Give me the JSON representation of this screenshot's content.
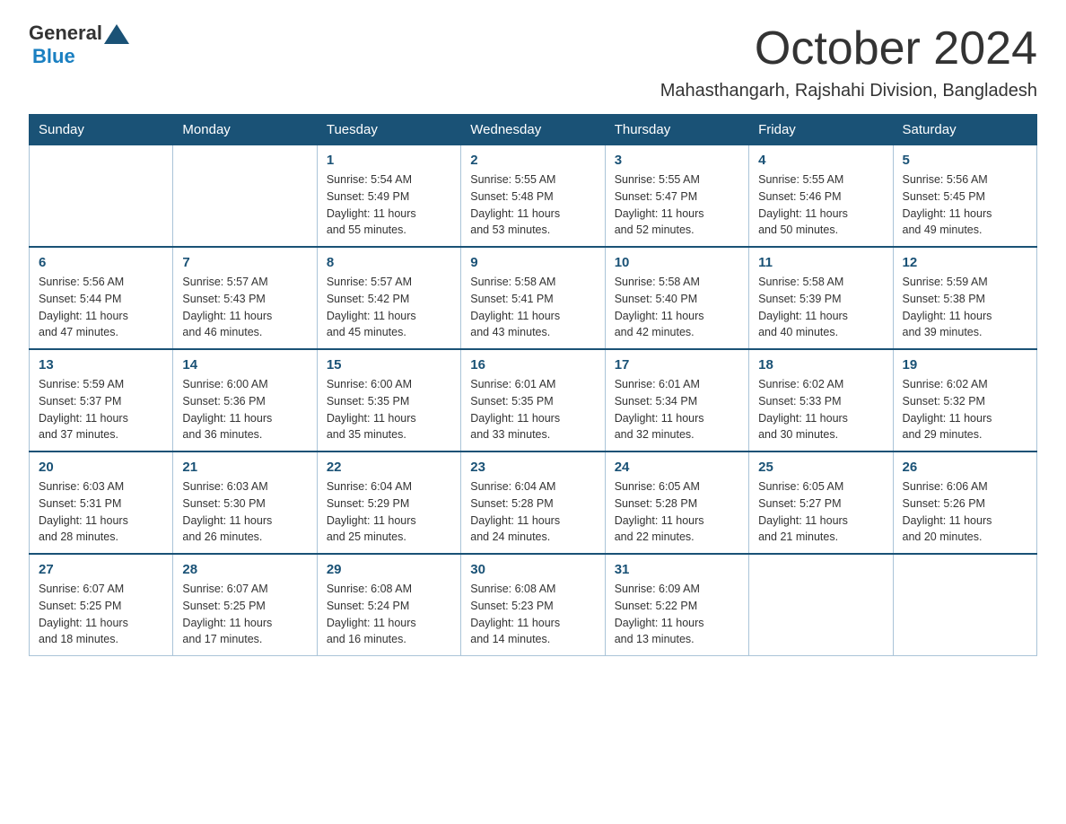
{
  "logo": {
    "general": "General",
    "blue": "Blue",
    "triangle_color": "#1a5276"
  },
  "title": "October 2024",
  "subtitle": "Mahasthangarh, Rajshahi Division, Bangladesh",
  "days_of_week": [
    "Sunday",
    "Monday",
    "Tuesday",
    "Wednesday",
    "Thursday",
    "Friday",
    "Saturday"
  ],
  "weeks": [
    [
      {
        "day": "",
        "info": ""
      },
      {
        "day": "",
        "info": ""
      },
      {
        "day": "1",
        "info": "Sunrise: 5:54 AM\nSunset: 5:49 PM\nDaylight: 11 hours\nand 55 minutes."
      },
      {
        "day": "2",
        "info": "Sunrise: 5:55 AM\nSunset: 5:48 PM\nDaylight: 11 hours\nand 53 minutes."
      },
      {
        "day": "3",
        "info": "Sunrise: 5:55 AM\nSunset: 5:47 PM\nDaylight: 11 hours\nand 52 minutes."
      },
      {
        "day": "4",
        "info": "Sunrise: 5:55 AM\nSunset: 5:46 PM\nDaylight: 11 hours\nand 50 minutes."
      },
      {
        "day": "5",
        "info": "Sunrise: 5:56 AM\nSunset: 5:45 PM\nDaylight: 11 hours\nand 49 minutes."
      }
    ],
    [
      {
        "day": "6",
        "info": "Sunrise: 5:56 AM\nSunset: 5:44 PM\nDaylight: 11 hours\nand 47 minutes."
      },
      {
        "day": "7",
        "info": "Sunrise: 5:57 AM\nSunset: 5:43 PM\nDaylight: 11 hours\nand 46 minutes."
      },
      {
        "day": "8",
        "info": "Sunrise: 5:57 AM\nSunset: 5:42 PM\nDaylight: 11 hours\nand 45 minutes."
      },
      {
        "day": "9",
        "info": "Sunrise: 5:58 AM\nSunset: 5:41 PM\nDaylight: 11 hours\nand 43 minutes."
      },
      {
        "day": "10",
        "info": "Sunrise: 5:58 AM\nSunset: 5:40 PM\nDaylight: 11 hours\nand 42 minutes."
      },
      {
        "day": "11",
        "info": "Sunrise: 5:58 AM\nSunset: 5:39 PM\nDaylight: 11 hours\nand 40 minutes."
      },
      {
        "day": "12",
        "info": "Sunrise: 5:59 AM\nSunset: 5:38 PM\nDaylight: 11 hours\nand 39 minutes."
      }
    ],
    [
      {
        "day": "13",
        "info": "Sunrise: 5:59 AM\nSunset: 5:37 PM\nDaylight: 11 hours\nand 37 minutes."
      },
      {
        "day": "14",
        "info": "Sunrise: 6:00 AM\nSunset: 5:36 PM\nDaylight: 11 hours\nand 36 minutes."
      },
      {
        "day": "15",
        "info": "Sunrise: 6:00 AM\nSunset: 5:35 PM\nDaylight: 11 hours\nand 35 minutes."
      },
      {
        "day": "16",
        "info": "Sunrise: 6:01 AM\nSunset: 5:35 PM\nDaylight: 11 hours\nand 33 minutes."
      },
      {
        "day": "17",
        "info": "Sunrise: 6:01 AM\nSunset: 5:34 PM\nDaylight: 11 hours\nand 32 minutes."
      },
      {
        "day": "18",
        "info": "Sunrise: 6:02 AM\nSunset: 5:33 PM\nDaylight: 11 hours\nand 30 minutes."
      },
      {
        "day": "19",
        "info": "Sunrise: 6:02 AM\nSunset: 5:32 PM\nDaylight: 11 hours\nand 29 minutes."
      }
    ],
    [
      {
        "day": "20",
        "info": "Sunrise: 6:03 AM\nSunset: 5:31 PM\nDaylight: 11 hours\nand 28 minutes."
      },
      {
        "day": "21",
        "info": "Sunrise: 6:03 AM\nSunset: 5:30 PM\nDaylight: 11 hours\nand 26 minutes."
      },
      {
        "day": "22",
        "info": "Sunrise: 6:04 AM\nSunset: 5:29 PM\nDaylight: 11 hours\nand 25 minutes."
      },
      {
        "day": "23",
        "info": "Sunrise: 6:04 AM\nSunset: 5:28 PM\nDaylight: 11 hours\nand 24 minutes."
      },
      {
        "day": "24",
        "info": "Sunrise: 6:05 AM\nSunset: 5:28 PM\nDaylight: 11 hours\nand 22 minutes."
      },
      {
        "day": "25",
        "info": "Sunrise: 6:05 AM\nSunset: 5:27 PM\nDaylight: 11 hours\nand 21 minutes."
      },
      {
        "day": "26",
        "info": "Sunrise: 6:06 AM\nSunset: 5:26 PM\nDaylight: 11 hours\nand 20 minutes."
      }
    ],
    [
      {
        "day": "27",
        "info": "Sunrise: 6:07 AM\nSunset: 5:25 PM\nDaylight: 11 hours\nand 18 minutes."
      },
      {
        "day": "28",
        "info": "Sunrise: 6:07 AM\nSunset: 5:25 PM\nDaylight: 11 hours\nand 17 minutes."
      },
      {
        "day": "29",
        "info": "Sunrise: 6:08 AM\nSunset: 5:24 PM\nDaylight: 11 hours\nand 16 minutes."
      },
      {
        "day": "30",
        "info": "Sunrise: 6:08 AM\nSunset: 5:23 PM\nDaylight: 11 hours\nand 14 minutes."
      },
      {
        "day": "31",
        "info": "Sunrise: 6:09 AM\nSunset: 5:22 PM\nDaylight: 11 hours\nand 13 minutes."
      },
      {
        "day": "",
        "info": ""
      },
      {
        "day": "",
        "info": ""
      }
    ]
  ]
}
